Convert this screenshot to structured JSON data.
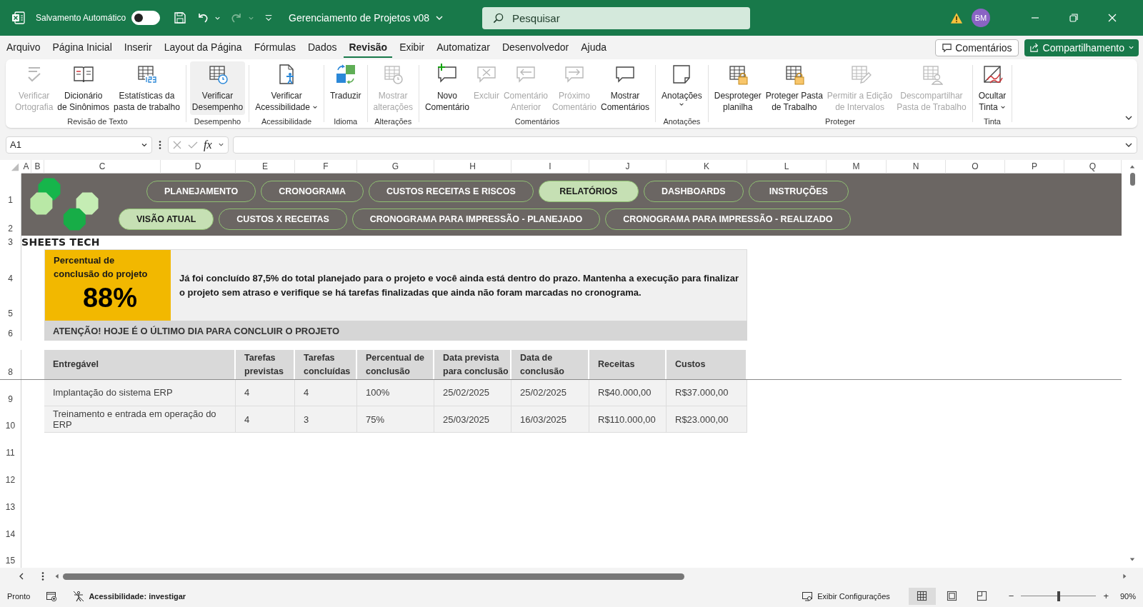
{
  "title_bar": {
    "autosave_label": "Salvamento Automático",
    "autosave_on": false,
    "document_title": "Gerenciamento de Projetos v08",
    "search_placeholder": "Pesquisar",
    "user_initials": "BM"
  },
  "menu_tabs": [
    {
      "label": "Arquivo",
      "selected": false
    },
    {
      "label": "Página Inicial",
      "selected": false
    },
    {
      "label": "Inserir",
      "selected": false
    },
    {
      "label": "Layout da Página",
      "selected": false
    },
    {
      "label": "Fórmulas",
      "selected": false
    },
    {
      "label": "Dados",
      "selected": false
    },
    {
      "label": "Revisão",
      "selected": true
    },
    {
      "label": "Exibir",
      "selected": false
    },
    {
      "label": "Automatizar",
      "selected": false
    },
    {
      "label": "Desenvolvedor",
      "selected": false
    },
    {
      "label": "Ajuda",
      "selected": false
    }
  ],
  "comments_button": "Comentários",
  "share_button": "Compartilhamento",
  "ribbon_groups": [
    {
      "label": "Revisão de Texto",
      "commands": [
        {
          "lines": [
            "Verificar",
            "Ortografia"
          ],
          "disabled": true,
          "highlighted": false,
          "dropdown": false
        },
        {
          "lines": [
            "Dicionário",
            "de Sinônimos"
          ],
          "disabled": false,
          "highlighted": false,
          "dropdown": false
        },
        {
          "lines": [
            "Estatísticas da",
            "pasta de trabalho"
          ],
          "disabled": false,
          "highlighted": false,
          "dropdown": false
        }
      ]
    },
    {
      "label": "Desempenho",
      "commands": [
        {
          "lines": [
            "Verificar",
            "Desempenho"
          ],
          "disabled": false,
          "highlighted": true,
          "dropdown": false
        }
      ]
    },
    {
      "label": "Acessibilidade",
      "commands": [
        {
          "lines": [
            "Verificar",
            "Acessibilidade"
          ],
          "disabled": false,
          "highlighted": false,
          "dropdown": true
        }
      ]
    },
    {
      "label": "Idioma",
      "commands": [
        {
          "lines": [
            "Traduzir"
          ],
          "disabled": false,
          "highlighted": false,
          "dropdown": false
        }
      ]
    },
    {
      "label": "Alterações",
      "commands": [
        {
          "lines": [
            "Mostrar",
            "alterações"
          ],
          "disabled": true,
          "highlighted": false,
          "dropdown": false
        }
      ]
    },
    {
      "label": "Comentários",
      "commands": [
        {
          "lines": [
            "Novo",
            "Comentário"
          ],
          "disabled": false,
          "highlighted": false,
          "dropdown": false
        },
        {
          "lines": [
            "Excluir"
          ],
          "disabled": true,
          "highlighted": false,
          "dropdown": false
        },
        {
          "lines": [
            "Comentário",
            "Anterior"
          ],
          "disabled": true,
          "highlighted": false,
          "dropdown": false
        },
        {
          "lines": [
            "Próximo",
            "Comentário"
          ],
          "disabled": true,
          "highlighted": false,
          "dropdown": false
        },
        {
          "lines": [
            "Mostrar",
            "Comentários"
          ],
          "disabled": false,
          "highlighted": false,
          "dropdown": false
        }
      ]
    },
    {
      "label": "Anotações",
      "commands": [
        {
          "lines": [
            "Anotações"
          ],
          "disabled": false,
          "highlighted": false,
          "dropdown": true
        }
      ]
    },
    {
      "label": "Proteger",
      "commands": [
        {
          "lines": [
            "Desproteger",
            "planilha"
          ],
          "disabled": false,
          "highlighted": false,
          "dropdown": false
        },
        {
          "lines": [
            "Proteger Pasta",
            "de Trabalho"
          ],
          "disabled": false,
          "highlighted": false,
          "dropdown": false
        },
        {
          "lines": [
            "Permitir a Edição",
            "de Intervalos"
          ],
          "disabled": true,
          "highlighted": false,
          "dropdown": false
        },
        {
          "lines": [
            "Descompartilhar",
            "Pasta de Trabalho"
          ],
          "disabled": true,
          "highlighted": false,
          "dropdown": false
        }
      ]
    },
    {
      "label": "Tinta",
      "commands": [
        {
          "lines": [
            "Ocultar",
            "Tinta"
          ],
          "disabled": false,
          "highlighted": false,
          "dropdown": true
        }
      ]
    }
  ],
  "formula_bar": {
    "name_box": "A1",
    "function_label": "fx"
  },
  "column_headers": [
    "A",
    "B",
    "C",
    "D",
    "E",
    "F",
    "G",
    "H",
    "I",
    "J",
    "K",
    "L",
    "M",
    "N",
    "O",
    "P",
    "Q"
  ],
  "row_headers": [
    "1",
    "2",
    "3",
    "4",
    "5",
    "6",
    "8",
    "9",
    "10",
    "11",
    "12",
    "13",
    "14",
    "15"
  ],
  "sheet": {
    "brand": "SHEETS TECH",
    "nav_primary": [
      {
        "label": "PLANEJAMENTO",
        "selected": false
      },
      {
        "label": "CRONOGRAMA",
        "selected": false
      },
      {
        "label": "CUSTOS RECEITAS E RISCOS",
        "selected": false
      },
      {
        "label": "RELATÓRIOS",
        "selected": true
      },
      {
        "label": "DASHBOARDS",
        "selected": false
      },
      {
        "label": "INSTRUÇÕES",
        "selected": false
      }
    ],
    "nav_secondary": [
      {
        "label": "VISÃO ATUAL",
        "selected": true
      },
      {
        "label": "CUSTOS X RECEITAS",
        "selected": false
      },
      {
        "label": "CRONOGRAMA PARA IMPRESSÃO - PLANEJADO",
        "selected": false
      },
      {
        "label": "CRONOGRAMA PARA IMPRESSÃO - REALIZADO",
        "selected": false
      }
    ],
    "progress": {
      "label": "Percentual de conclusão do projeto",
      "value": "88%",
      "message": "Já foi concluído 87,5% do total planejado para o projeto e você ainda está dentro do prazo. Mantenha a execução para finalizar o projeto sem atraso e verifique se há tarefas finalizadas que ainda não foram marcadas no cronograma.",
      "alert": "ATENÇÃO! HOJE É O ÚLTIMO DIA PARA CONCLUIR O PROJETO"
    },
    "table": {
      "columns": [
        {
          "lines": [
            "Entregável"
          ]
        },
        {
          "lines": [
            "Tarefas",
            "previstas"
          ]
        },
        {
          "lines": [
            "Tarefas",
            "concluídas"
          ]
        },
        {
          "lines": [
            "Percentual de",
            "conclusão"
          ]
        },
        {
          "lines": [
            "Data prevista",
            "para conclusão"
          ]
        },
        {
          "lines": [
            "Data de",
            "conclusão"
          ]
        },
        {
          "lines": [
            "Receitas"
          ]
        },
        {
          "lines": [
            "Custos"
          ]
        }
      ],
      "rows": [
        [
          "Implantação do sistema ERP",
          "4",
          "4",
          "100%",
          "25/02/2025",
          "25/02/2025",
          "R$40.000,00",
          "R$37.000,00"
        ],
        [
          "Treinamento e entrada em operação do ERP",
          "4",
          "3",
          "75%",
          "25/03/2025",
          "16/03/2025",
          "R$110.000,00",
          "R$23.000,00"
        ]
      ]
    }
  },
  "status_bar": {
    "ready": "Pronto",
    "accessibility": "Acessibilidade: investigar",
    "display_settings": "Exibir Configurações",
    "views": [
      {
        "selected": true
      },
      {
        "selected": false
      },
      {
        "selected": false
      }
    ],
    "zoom_out": "−",
    "zoom_in": "+",
    "zoom": {
      "level": 0.5
    },
    "zoom_label": "90%"
  }
}
